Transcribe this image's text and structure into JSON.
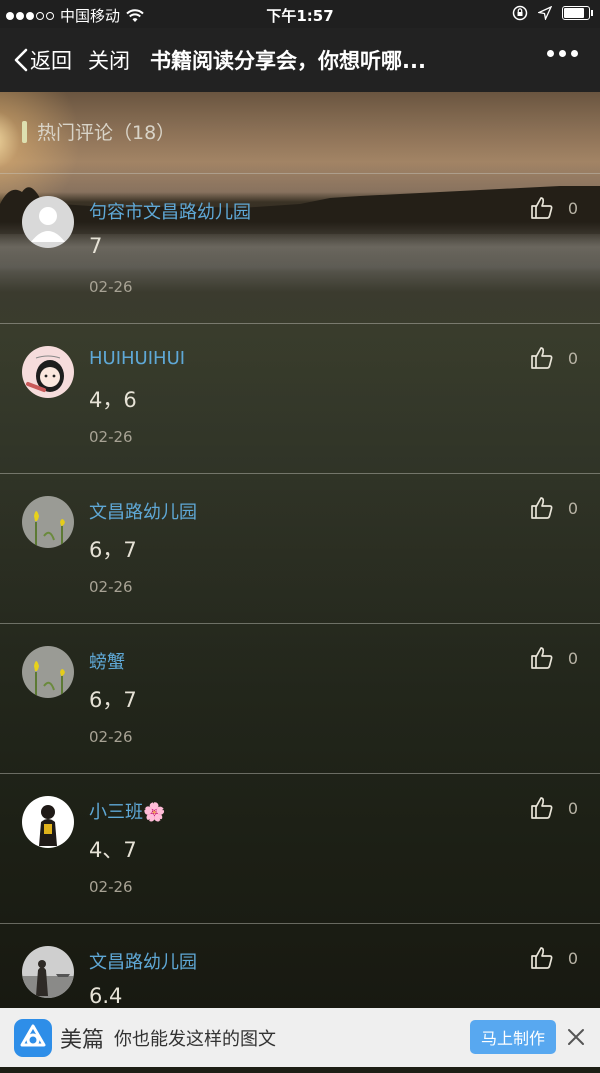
{
  "status_bar": {
    "carrier": "中国移动",
    "time": "下午1:57",
    "signal_bars": 3,
    "battery_level": 0.9
  },
  "nav": {
    "back_label": "返回",
    "close_label": "关闭",
    "title": "书籍阅读分享会，你想听哪..."
  },
  "comments_section": {
    "title": "热门评论（18）"
  },
  "comments": [
    {
      "username": "句容市文昌路幼儿园",
      "text": "7",
      "date": "02-26",
      "likes": "0",
      "avatar": "default-user"
    },
    {
      "username": "HUIHUIHUI",
      "text": "4，6",
      "date": "02-26",
      "likes": "0",
      "avatar": "cartoon-girl"
    },
    {
      "username": "文昌路幼儿园",
      "text": "6，7",
      "date": "02-26",
      "likes": "0",
      "avatar": "tulip"
    },
    {
      "username": "螃蟹",
      "text": "6，7",
      "date": "02-26",
      "likes": "0",
      "avatar": "tulip"
    },
    {
      "username": "小三班🌸",
      "text": "4、7",
      "date": "02-26",
      "likes": "0",
      "avatar": "figure"
    },
    {
      "username": "文昌路幼儿园",
      "text": "6.4",
      "date": "",
      "likes": "0",
      "avatar": "landscape"
    }
  ],
  "banner": {
    "brand": "美篇",
    "slogan": "你也能发这样的图文",
    "cta_label": "马上制作"
  },
  "colors": {
    "username": "#5fa8d6",
    "banner_cta": "#58a8f0",
    "brand_logo": "#2e8ee8"
  }
}
